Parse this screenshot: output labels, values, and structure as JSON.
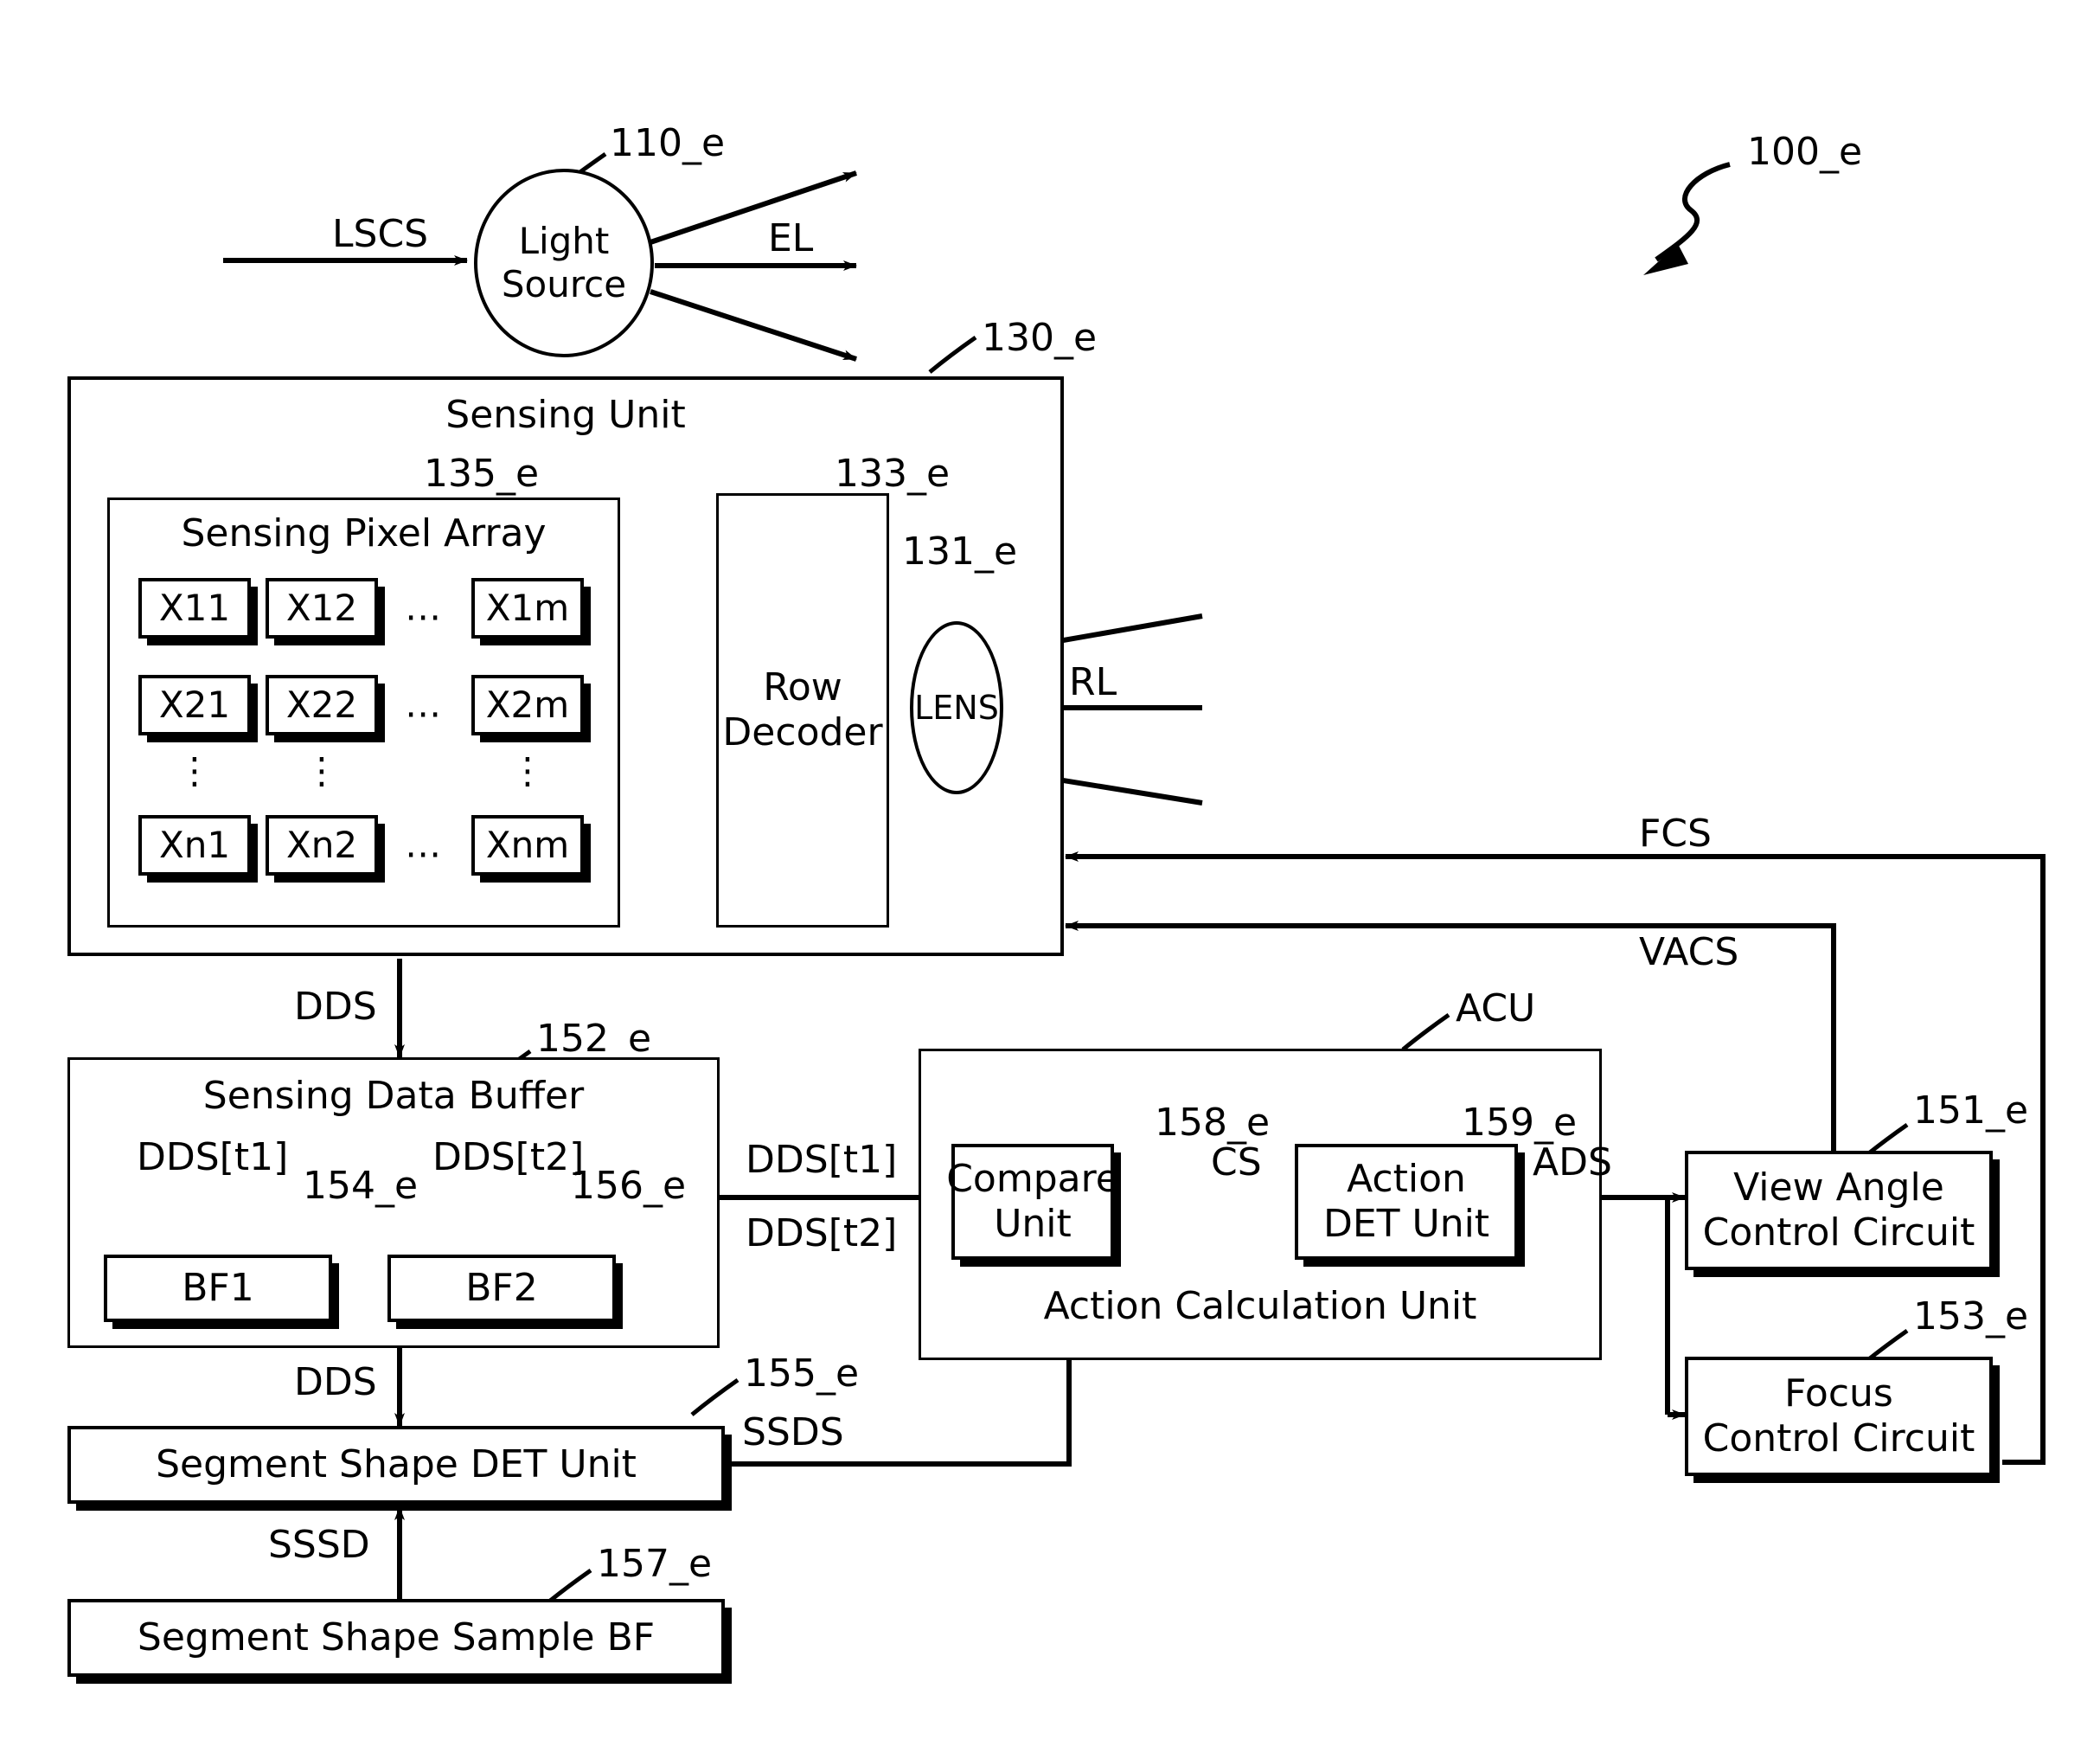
{
  "figure": {
    "ref_top": "100_e"
  },
  "light_source": {
    "label_line1": "Light",
    "label_line2": "Source",
    "ref": "110_e",
    "input_signal": "LSCS",
    "output_signal": "EL"
  },
  "sensing_unit": {
    "title": "Sensing Unit",
    "ref": "130_e",
    "pixel_array": {
      "title": "Sensing Pixel Array",
      "ref": "135_e",
      "rows": [
        [
          "X11",
          "X12",
          "⋯",
          "X1m"
        ],
        [
          "X21",
          "X22",
          "⋯",
          "X2m"
        ],
        [
          "⋮",
          "⋮",
          "",
          "⋮"
        ],
        [
          "Xn1",
          "Xn2",
          "⋯",
          "Xnm"
        ]
      ]
    },
    "row_decoder": {
      "label_line1": "Row",
      "label_line2": "Decoder",
      "ref": "133_e"
    },
    "lens": {
      "label": "LENS",
      "ref": "131_e",
      "input_signal": "RL"
    }
  },
  "sensing_data_buffer": {
    "title": "Sensing Data Buffer",
    "ref": "152_e",
    "input_signal": "DDS",
    "output_signal": "DDS",
    "bf1": {
      "label": "BF1",
      "ref": "154_e",
      "input_signal": "DDS[t1]"
    },
    "bf2": {
      "label": "BF2",
      "ref": "156_e",
      "input_signal": "DDS[t2]"
    },
    "out_signal_1": "DDS[t1]",
    "out_signal_2": "DDS[t2]"
  },
  "segment_shape_det_unit": {
    "label": "Segment Shape DET Unit",
    "ref": "155_e",
    "output_signal": "SSDS"
  },
  "segment_shape_sample_bf": {
    "label": "Segment Shape Sample BF",
    "ref": "157_e",
    "output_signal": "SSSD"
  },
  "action_calculation_unit": {
    "title": "Action Calculation Unit",
    "ref": "ACU",
    "compare_unit": {
      "label_line1": "Compare",
      "label_line2": "Unit",
      "ref": "158_e",
      "output_signal": "CS"
    },
    "action_det_unit": {
      "label_line1": "Action",
      "label_line2": "DET Unit",
      "ref": "159_e",
      "output_signal": "ADS"
    }
  },
  "view_angle_control_circuit": {
    "label_line1": "View Angle",
    "label_line2": "Control Circuit",
    "ref": "151_e",
    "output_signal": "VACS"
  },
  "focus_control_circuit": {
    "label_line1": "Focus",
    "label_line2": "Control Circuit",
    "ref": "153_e",
    "output_signal": "FCS"
  }
}
